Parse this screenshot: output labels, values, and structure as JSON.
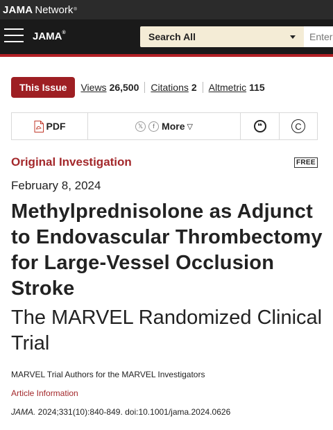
{
  "network_bar": {
    "brand": "JAMA",
    "network": "Network",
    "tm": "®"
  },
  "header": {
    "logo": "JAMA",
    "logo_mark": "®",
    "search_scope": "Search All",
    "search_placeholder": "Enter Search Term"
  },
  "issue_row": {
    "issue_button": "This Issue",
    "views_label": "Views",
    "views_value": "26,500",
    "citations_label": "Citations",
    "citations_value": "2",
    "altmetric_label": "Altmetric",
    "altmetric_value": "115"
  },
  "toolbar": {
    "pdf_label": "PDF",
    "more_label": "More",
    "more_caret": "▽",
    "x_glyph": "𝕏",
    "fb_glyph": "f",
    "cite_glyph": "❝",
    "cc_glyph": "C"
  },
  "article": {
    "type": "Original Investigation",
    "badge": "FREE",
    "date": "February 8, 2024",
    "title": "Methylprednisolone as Adjunct to Endovascular Thrombectomy for Large-Vessel Occlusion Stroke",
    "subtitle": "The MARVEL Randomized Clinical Trial",
    "authors": "MARVEL Trial Authors for the MARVEL Investigators",
    "article_info": "Article Information",
    "journal": "JAMA.",
    "citation": " 2024;331(10):840-849. doi:10.1001/jama.2024.0626"
  },
  "colors": {
    "accent_red": "#a3282b",
    "issue_button_bg": "#9e1f23",
    "search_select_bg": "#f4ecd6",
    "header_bg": "#1a1a1a"
  },
  "icons": [
    "menu-icon",
    "pdf-icon",
    "x-social-icon",
    "facebook-icon",
    "cite-icon",
    "copyright-icon",
    "chevron-down-icon"
  ]
}
